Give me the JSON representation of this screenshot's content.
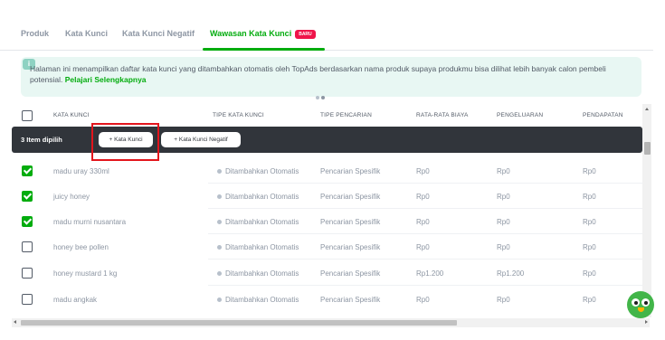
{
  "tabs": [
    {
      "label": "Produk"
    },
    {
      "label": "Kata Kunci"
    },
    {
      "label": "Kata Kunci Negatif"
    },
    {
      "label": "Wawasan Kata Kunci",
      "badge": "BARU",
      "active": true
    }
  ],
  "info": {
    "text": "Halaman ini menampilkan daftar kata kunci yang ditambahkan otomatis oleh TopAds berdasarkan nama produk supaya produkmu bisa dilihat lebih banyak calon pembeli potensial.",
    "link": "Pelajari Selengkapnya",
    "icon": "info-icon"
  },
  "table": {
    "headers": [
      "KATA KUNCI",
      "TIPE KATA KUNCI",
      "TIPE PENCARIAN",
      "RATA-RATA BIAYA",
      "PENGELUARAN",
      "PENDAPATAN"
    ],
    "selection": {
      "count_text": "3 Item dipilih",
      "add_keyword": "+ Kata Kunci",
      "add_negative": "+ Kata Kunci Negatif"
    },
    "rows": [
      {
        "checked": true,
        "keyword": "madu uray 330ml",
        "type": "Ditambahkan Otomatis",
        "search": "Pencarian Spesifik",
        "avg_cost": "Rp0",
        "spend": "Rp0",
        "revenue": "Rp0"
      },
      {
        "checked": true,
        "keyword": "juicy honey",
        "type": "Ditambahkan Otomatis",
        "search": "Pencarian Spesifik",
        "avg_cost": "Rp0",
        "spend": "Rp0",
        "revenue": "Rp0"
      },
      {
        "checked": true,
        "keyword": "madu murni nusantara",
        "type": "Ditambahkan Otomatis",
        "search": "Pencarian Spesifik",
        "avg_cost": "Rp0",
        "spend": "Rp0",
        "revenue": "Rp0"
      },
      {
        "checked": false,
        "keyword": "honey bee pollen",
        "type": "Ditambahkan Otomatis",
        "search": "Pencarian Spesifik",
        "avg_cost": "Rp0",
        "spend": "Rp0",
        "revenue": "Rp0"
      },
      {
        "checked": false,
        "keyword": "honey mustard 1 kg",
        "type": "Ditambahkan Otomatis",
        "search": "Pencarian Spesifik",
        "avg_cost": "Rp1.200",
        "spend": "Rp1.200",
        "revenue": "Rp0"
      },
      {
        "checked": false,
        "keyword": "madu angkak",
        "type": "Ditambahkan Otomatis",
        "search": "Pencarian Spesifik",
        "avg_cost": "Rp0",
        "spend": "Rp0",
        "revenue": "Rp0"
      }
    ]
  },
  "colors": {
    "accent": "#03ac0e",
    "badge": "#ef144a",
    "selection_bar": "#31353b",
    "highlight": "#e3151c"
  },
  "mascot_icon": "toped-owl-icon"
}
